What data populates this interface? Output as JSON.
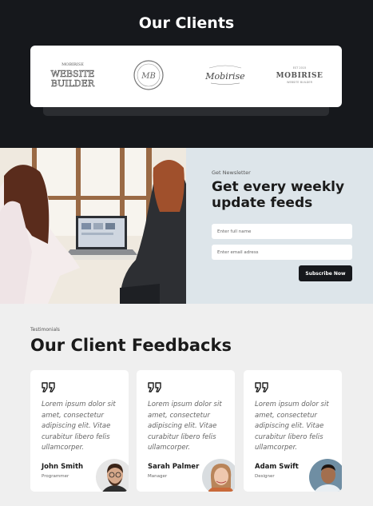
{
  "clients": {
    "title": "Our Clients",
    "logos": [
      {
        "name": "Mobirise Website Builder",
        "top_text": "MOBIRISE",
        "big_text": "WEBSITE BUILDER"
      },
      {
        "name": "MB seal",
        "text": "MB"
      },
      {
        "name": "Mobirise script",
        "text": "Mobirise"
      },
      {
        "name": "Mobirise wordmark",
        "top_text": "EST 2015",
        "text": "MOBIRISE",
        "sub_text": "WEBSITE BUILDER"
      }
    ]
  },
  "newsletter": {
    "kicker": "Get Newsletter",
    "title": "Get every weekly update feeds",
    "name_placeholder": "Enter full name",
    "email_placeholder": "Enter email adress",
    "button": "Subscribe Now"
  },
  "testimonials": {
    "kicker": "Testimonials",
    "title": "Our Client Feedbacks",
    "items": [
      {
        "quote": "Lorem ipsum dolor sit amet, consectetur adipiscing elit. Vitae curabitur libero felis ullamcorper.",
        "name": "John Smith",
        "role": "Programmer"
      },
      {
        "quote": "Lorem ipsum dolor sit amet, consectetur adipiscing elit. Vitae curabitur libero felis ullamcorper.",
        "name": "Sarah Palmer",
        "role": "Manager"
      },
      {
        "quote": "Lorem ipsum dolor sit amet, consectetur adipiscing elit. Vitae curabitur libero felis ullamcorper.",
        "name": "Adam Swift",
        "role": "Designer"
      }
    ]
  },
  "colors": {
    "dark": "#16181c",
    "newsletter_bg": "#dde5ea",
    "page_bg": "#efefef"
  }
}
